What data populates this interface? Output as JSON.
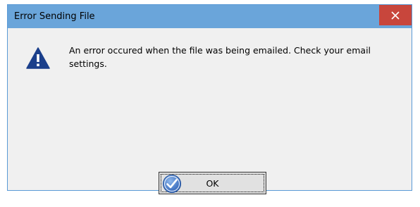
{
  "dialog": {
    "title": "Error Sending File",
    "close_icon": "close-icon",
    "warning_icon": "warning-triangle-icon",
    "message": "An error occured when the file was being emailed. Check your email settings.",
    "ok_button": {
      "label": "OK",
      "icon": "checkmark-circle-icon"
    }
  },
  "colors": {
    "titlebar": "#6aa5da",
    "close_button": "#c8463c",
    "body": "#f0f0f0",
    "warning_icon": "#1b3f8b",
    "ok_check": "#3a6fc4"
  }
}
